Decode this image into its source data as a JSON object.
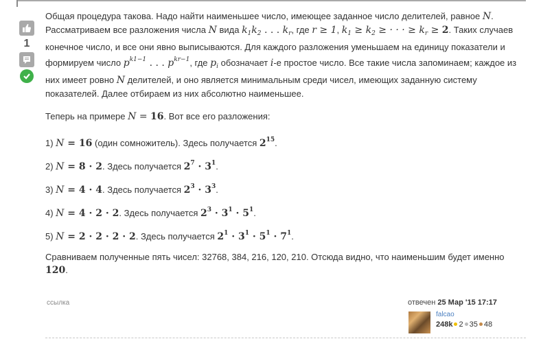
{
  "vote": {
    "count": "1"
  },
  "intro": {
    "t1": "Общая процедура такова. Надо найти наименьшее число, имеющее заданное число делителей, равное ",
    "N": "N",
    "t2": ". Рассматриваем все разложения числа ",
    "t3": " вида ",
    "k": "k",
    "s1": "1",
    "s2": "2",
    "dots": " . . . ",
    "sr": "r",
    "t4": ", где ",
    "cond1": "r ≥ 1",
    "comma": ", ",
    "cond2a": "k",
    "cond2b": " ≥ k",
    "cond2c": " ≥ · · · ≥ k",
    "cond2d": " ≥ ",
    "two": "2",
    "t5": ". Таких случаев конечное число, и все они явно выписываются. Для каждого разложения уменьшаем на единицу показатели и формируем число ",
    "p": "p",
    "supk1": "k",
    "sup1m": "1",
    "supm1": "−1",
    "supkr": "k",
    "suprm": "r",
    "t6": ", где ",
    "pi": "p",
    "i": "i",
    "t7": " обозначает ",
    "ivar": "i",
    "t8": "-е простое число. Все такие числа запоминаем; каждое из них имеет ровно ",
    "t9": " делителей, и оно является минимальным среди чисел, имеющих заданную систему показателей. Далее отбираем из них абсолютно наименьшее."
  },
  "example": {
    "pre": "Теперь на примере ",
    "eq": "N = ",
    "val": "16",
    "post": ". Вот все его разложения:"
  },
  "items": [
    {
      "num": "1) ",
      "lhs": "N",
      "expr": " = 16",
      "note": " (один сомножитель). Здесь получается ",
      "res": "2",
      "exp": "15",
      "rest": [],
      "end": "."
    },
    {
      "num": "2) ",
      "lhs": "N",
      "expr": " = 8 · 2",
      "note": ". Здесь получается ",
      "res": "2",
      "exp": "7",
      "rest": [
        {
          "b": " · 3",
          "e": "1"
        }
      ],
      "end": "."
    },
    {
      "num": "3) ",
      "lhs": "N",
      "expr": " = 4 · 4",
      "note": ". Здесь получается ",
      "res": "2",
      "exp": "3",
      "rest": [
        {
          "b": " · 3",
          "e": "3"
        }
      ],
      "end": "."
    },
    {
      "num": "4) ",
      "lhs": "N",
      "expr": " = 4 · 2 · 2",
      "note": ". Здесь получается ",
      "res": "2",
      "exp": "3",
      "rest": [
        {
          "b": " · 3",
          "e": "1"
        },
        {
          "b": " · 5",
          "e": "1"
        }
      ],
      "end": "."
    },
    {
      "num": "5) ",
      "lhs": "N",
      "expr": " = 2 · 2 · 2 · 2",
      "note": ". Здесь получается ",
      "res": "2",
      "exp": "1",
      "rest": [
        {
          "b": " · 3",
          "e": "1"
        },
        {
          "b": " · 5",
          "e": "1"
        },
        {
          "b": " · 7",
          "e": "1"
        }
      ],
      "end": "."
    }
  ],
  "conclusion": {
    "text": "Сравниваем полученные пять чисел: 32768, 384, 216, 120, 210. Отсюда видно, что наименьшим будет именно ",
    "val": "120",
    "end": "."
  },
  "footer": {
    "link": "ссылка",
    "answered_label": "отвечен ",
    "answered_date": "25 Мар '15 17:17",
    "user": "falcao",
    "rep": "248k",
    "gold": "2",
    "silver": "35",
    "bronze": "48",
    "colors": {
      "gold": "#f0c000",
      "silver": "#b8b8b8",
      "bronze": "#c48a4a"
    }
  },
  "icons": {
    "up": "thumbs-up-icon",
    "down": "comment-icon",
    "accept": "checkmark-icon"
  }
}
